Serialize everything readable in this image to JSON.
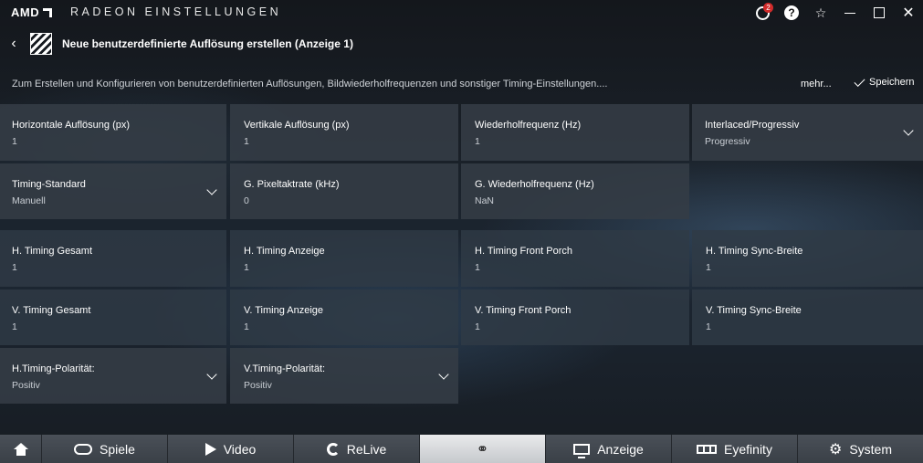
{
  "app": {
    "brand": "AMD",
    "title": "RADEON EINSTELLUNGEN",
    "notification_count": "2",
    "help_glyph": "?",
    "star_glyph": "☆"
  },
  "page": {
    "title": "Neue benutzerdefinierte Auflösung erstellen (Anzeige 1)",
    "description": "Zum Erstellen und Konfigurieren von benutzerdefinierten Auflösungen, Bildwiederholfrequenzen und sonstiger Timing-Einstellungen....",
    "more_label": "mehr...",
    "save_label": "Speichern"
  },
  "fields": {
    "h_res": {
      "label": "Horizontale Auflösung (px)",
      "value": "1"
    },
    "v_res": {
      "label": "Vertikale Auflösung (px)",
      "value": "1"
    },
    "refresh": {
      "label": "Wiederholfrequenz (Hz)",
      "value": "1"
    },
    "interlaced": {
      "label": "Interlaced/Progressiv",
      "value": "Progressiv"
    },
    "timing_std": {
      "label": "Timing-Standard",
      "value": "Manuell"
    },
    "pixel_clock": {
      "label": "G. Pixeltaktrate (kHz)",
      "value": "0"
    },
    "g_refresh": {
      "label": "G. Wiederholfrequenz (Hz)",
      "value": "NaN"
    },
    "h_total": {
      "label": "H. Timing Gesamt",
      "value": "1"
    },
    "h_display": {
      "label": "H. Timing Anzeige",
      "value": "1"
    },
    "h_front": {
      "label": "H. Timing Front Porch",
      "value": "1"
    },
    "h_sync": {
      "label": "H. Timing Sync-Breite",
      "value": "1"
    },
    "v_total": {
      "label": "V. Timing Gesamt",
      "value": "1"
    },
    "v_display": {
      "label": "V. Timing Anzeige",
      "value": "1"
    },
    "v_front": {
      "label": "V. Timing Front Porch",
      "value": "1"
    },
    "v_sync": {
      "label": "V. Timing Sync-Breite",
      "value": "1"
    },
    "h_polarity": {
      "label": "H.Timing-Polarität:",
      "value": "Positiv"
    },
    "v_polarity": {
      "label": "V.Timing-Polarität:",
      "value": "Positiv"
    }
  },
  "nav": {
    "spiele": "Spiele",
    "video": "Video",
    "relive": "ReLive",
    "anzeige": "Anzeige",
    "eyefinity": "Eyefinity",
    "system": "System"
  }
}
